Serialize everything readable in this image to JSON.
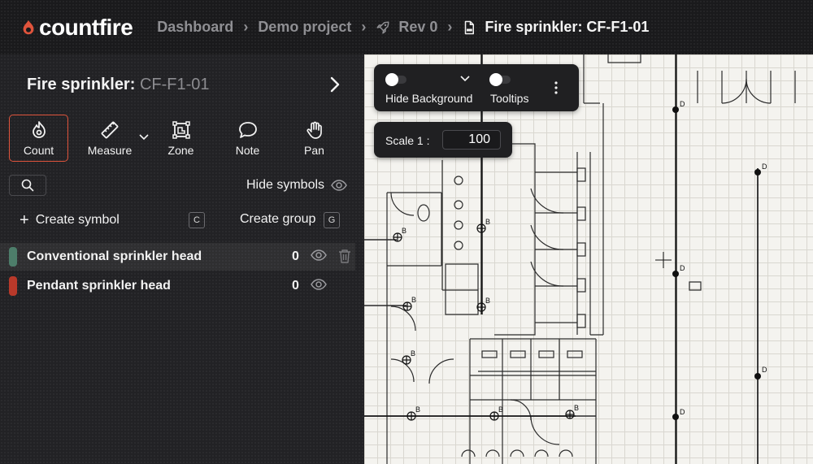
{
  "header": {
    "logo_text": "countfire",
    "breadcrumbs": [
      {
        "label": "Dashboard"
      },
      {
        "label": "Demo project"
      },
      {
        "label": "Rev 0"
      },
      {
        "label": "Fire sprinkler: CF-F1-01"
      }
    ]
  },
  "sidebar": {
    "title": "Fire sprinkler:",
    "title_code": "CF-F1-01",
    "tools": [
      {
        "label": "Count",
        "icon": "flame-icon"
      },
      {
        "label": "Measure",
        "icon": "ruler-icon"
      },
      {
        "label": "Zone",
        "icon": "zone-icon"
      },
      {
        "label": "Note",
        "icon": "speech-bubble-icon"
      },
      {
        "label": "Pan",
        "icon": "hand-icon"
      }
    ],
    "hide_symbols_label": "Hide symbols",
    "create_symbol_label": "Create symbol",
    "create_symbol_shortcut": "C",
    "create_group_label": "Create group",
    "create_group_shortcut": "G",
    "symbols": [
      {
        "name": "Conventional sprinkler head",
        "count": "0",
        "color": "#4d7d6a"
      },
      {
        "name": "Pendant sprinkler head",
        "count": "0",
        "color": "#b8392a"
      }
    ]
  },
  "canvas_toolbar": {
    "hide_background_label": "Hide Background",
    "tooltips_label": "Tooltips",
    "scale_label": "Scale 1 :",
    "scale_value": "100"
  },
  "plan_labels": {
    "b": "B",
    "d": "D"
  },
  "colors": {
    "accent": "#e0543c",
    "background": "#1e1e20"
  }
}
